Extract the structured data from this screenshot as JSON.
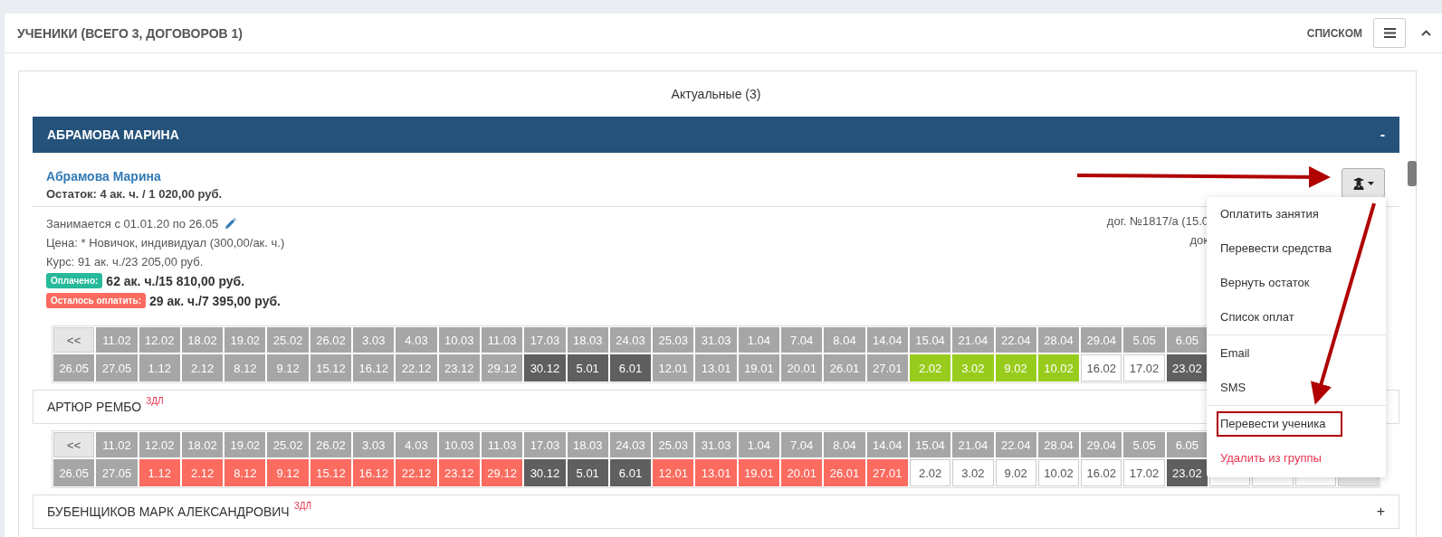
{
  "panel": {
    "title": "УЧЕНИКИ (ВСЕГО 3, ДОГОВОРОВ 1)",
    "view_label": "СПИСКОМ",
    "collapsed": false
  },
  "group": {
    "title": "Актуальные (3)"
  },
  "students": [
    {
      "name": "АБРАМОВА МАРИНА",
      "expanded": true,
      "toggle": "-",
      "card": {
        "link": "Абрамова Марина",
        "balance": "Остаток: 4 ак. ч. / 1 020,00 руб.",
        "lines": [
          "Занимается с 01.01.20 по 26.05",
          "Цена: * Новичок, индивидуал (300,00/ак. ч.)",
          "Курс: 91 ак. ч./23 205,00 руб."
        ],
        "contract": [
          "дог. №1817/а (15.0",
          "док"
        ],
        "payments": [
          {
            "kind": "paid",
            "badge": "Оплачено:",
            "value": "62 ак. ч./15 810,00 руб."
          },
          {
            "kind": "due",
            "badge": "Осталось оплатить:",
            "value": "29 ак. ч./7 395,00 руб."
          }
        ]
      },
      "schedule": [
        [
          {
            "label": "<<",
            "kind": "nav"
          },
          {
            "label": "11.02",
            "kind": "gray"
          },
          {
            "label": "12.02",
            "kind": "gray"
          },
          {
            "label": "18.02",
            "kind": "gray"
          },
          {
            "label": "19.02",
            "kind": "gray"
          },
          {
            "label": "25.02",
            "kind": "gray"
          },
          {
            "label": "26.02",
            "kind": "gray"
          },
          {
            "label": "3.03",
            "kind": "gray"
          },
          {
            "label": "4.03",
            "kind": "gray"
          },
          {
            "label": "10.03",
            "kind": "gray"
          },
          {
            "label": "11.03",
            "kind": "gray"
          },
          {
            "label": "17.03",
            "kind": "gray"
          },
          {
            "label": "18.03",
            "kind": "gray"
          },
          {
            "label": "24.03",
            "kind": "gray"
          },
          {
            "label": "25.03",
            "kind": "gray"
          },
          {
            "label": "31.03",
            "kind": "gray"
          },
          {
            "label": "1.04",
            "kind": "gray"
          },
          {
            "label": "7.04",
            "kind": "gray"
          },
          {
            "label": "8.04",
            "kind": "gray"
          },
          {
            "label": "14.04",
            "kind": "gray"
          },
          {
            "label": "15.04",
            "kind": "gray"
          },
          {
            "label": "21.04",
            "kind": "gray"
          },
          {
            "label": "22.04",
            "kind": "gray"
          },
          {
            "label": "28.04",
            "kind": "gray"
          },
          {
            "label": "29.04",
            "kind": "gray"
          },
          {
            "label": "5.05",
            "kind": "gray"
          },
          {
            "label": "6.05",
            "kind": "gray"
          }
        ],
        [
          {
            "label": "26.05",
            "kind": "gray"
          },
          {
            "label": "27.05",
            "kind": "gray"
          },
          {
            "label": "1.12",
            "kind": "gray"
          },
          {
            "label": "2.12",
            "kind": "gray"
          },
          {
            "label": "8.12",
            "kind": "gray"
          },
          {
            "label": "9.12",
            "kind": "gray"
          },
          {
            "label": "15.12",
            "kind": "gray"
          },
          {
            "label": "16.12",
            "kind": "gray"
          },
          {
            "label": "22.12",
            "kind": "gray"
          },
          {
            "label": "23.12",
            "kind": "gray"
          },
          {
            "label": "29.12",
            "kind": "gray"
          },
          {
            "label": "30.12",
            "kind": "dark"
          },
          {
            "label": "5.01",
            "kind": "dark"
          },
          {
            "label": "6.01",
            "kind": "dark"
          },
          {
            "label": "12.01",
            "kind": "gray"
          },
          {
            "label": "13.01",
            "kind": "gray"
          },
          {
            "label": "19.01",
            "kind": "gray"
          },
          {
            "label": "20.01",
            "kind": "gray"
          },
          {
            "label": "26.01",
            "kind": "gray"
          },
          {
            "label": "27.01",
            "kind": "gray"
          },
          {
            "label": "2.02",
            "kind": "green"
          },
          {
            "label": "3.02",
            "kind": "green"
          },
          {
            "label": "9.02",
            "kind": "green"
          },
          {
            "label": "10.02",
            "kind": "green"
          },
          {
            "label": "16.02",
            "kind": "open"
          },
          {
            "label": "17.02",
            "kind": "open"
          },
          {
            "label": "23.02",
            "kind": "dark"
          }
        ]
      ]
    },
    {
      "name": "АРТЮР РЕМБО",
      "tag": "ЗДЛ",
      "expanded": false,
      "schedule": [
        [
          {
            "label": "<<",
            "kind": "nav"
          },
          {
            "label": "11.02",
            "kind": "gray"
          },
          {
            "label": "12.02",
            "kind": "gray"
          },
          {
            "label": "18.02",
            "kind": "gray"
          },
          {
            "label": "19.02",
            "kind": "gray"
          },
          {
            "label": "25.02",
            "kind": "gray"
          },
          {
            "label": "26.02",
            "kind": "gray"
          },
          {
            "label": "3.03",
            "kind": "gray"
          },
          {
            "label": "4.03",
            "kind": "gray"
          },
          {
            "label": "10.03",
            "kind": "gray"
          },
          {
            "label": "11.03",
            "kind": "gray"
          },
          {
            "label": "17.03",
            "kind": "gray"
          },
          {
            "label": "18.03",
            "kind": "gray"
          },
          {
            "label": "24.03",
            "kind": "gray"
          },
          {
            "label": "25.03",
            "kind": "gray"
          },
          {
            "label": "31.03",
            "kind": "gray"
          },
          {
            "label": "1.04",
            "kind": "gray"
          },
          {
            "label": "7.04",
            "kind": "gray"
          },
          {
            "label": "8.04",
            "kind": "gray"
          },
          {
            "label": "14.04",
            "kind": "gray"
          },
          {
            "label": "15.04",
            "kind": "gray"
          },
          {
            "label": "21.04",
            "kind": "gray"
          },
          {
            "label": "22.04",
            "kind": "gray"
          },
          {
            "label": "28.04",
            "kind": "gray"
          },
          {
            "label": "29.04",
            "kind": "gray"
          },
          {
            "label": "5.05",
            "kind": "gray"
          },
          {
            "label": "6.05",
            "kind": "gray"
          }
        ],
        [
          {
            "label": "26.05",
            "kind": "gray"
          },
          {
            "label": "27.05",
            "kind": "gray"
          },
          {
            "label": "1.12",
            "kind": "red"
          },
          {
            "label": "2.12",
            "kind": "red"
          },
          {
            "label": "8.12",
            "kind": "red"
          },
          {
            "label": "9.12",
            "kind": "red"
          },
          {
            "label": "15.12",
            "kind": "red"
          },
          {
            "label": "16.12",
            "kind": "red"
          },
          {
            "label": "22.12",
            "kind": "red"
          },
          {
            "label": "23.12",
            "kind": "red"
          },
          {
            "label": "29.12",
            "kind": "red"
          },
          {
            "label": "30.12",
            "kind": "dark"
          },
          {
            "label": "5.01",
            "kind": "dark"
          },
          {
            "label": "6.01",
            "kind": "dark"
          },
          {
            "label": "12.01",
            "kind": "red"
          },
          {
            "label": "13.01",
            "kind": "red"
          },
          {
            "label": "19.01",
            "kind": "red"
          },
          {
            "label": "20.01",
            "kind": "red"
          },
          {
            "label": "26.01",
            "kind": "red"
          },
          {
            "label": "27.01",
            "kind": "red"
          },
          {
            "label": "2.02",
            "kind": "open"
          },
          {
            "label": "3.02",
            "kind": "open"
          },
          {
            "label": "9.02",
            "kind": "open"
          },
          {
            "label": "10.02",
            "kind": "open"
          },
          {
            "label": "16.02",
            "kind": "open"
          },
          {
            "label": "17.02",
            "kind": "open"
          },
          {
            "label": "23.02",
            "kind": "dark"
          },
          {
            "kind": "open"
          },
          {
            "kind": "open"
          },
          {
            "kind": "open"
          },
          {
            "kind": "nav"
          }
        ]
      ]
    },
    {
      "name": "БУБЕНЩИКОВ МАРК АЛЕКСАНДРОВИЧ",
      "tag": "ЗДЛ",
      "expanded": false,
      "toggle": "+"
    }
  ],
  "action_menu": {
    "open": true,
    "groups": [
      [
        {
          "label": "Оплатить занятия",
          "kind": "item",
          "highlighted": false
        },
        {
          "label": "Перевести средства",
          "kind": "item",
          "highlighted": false
        },
        {
          "label": "Вернуть остаток",
          "kind": "item",
          "highlighted": false
        },
        {
          "label": "Список оплат",
          "kind": "item",
          "highlighted": false
        }
      ],
      [
        {
          "label": "Email",
          "kind": "item",
          "highlighted": false
        },
        {
          "label": "SMS",
          "kind": "item",
          "highlighted": false
        }
      ],
      [
        {
          "label": "Перевести ученика",
          "kind": "item",
          "highlighted": true
        },
        {
          "label": "Удалить из группы",
          "kind": "danger",
          "highlighted": false
        }
      ]
    ]
  }
}
